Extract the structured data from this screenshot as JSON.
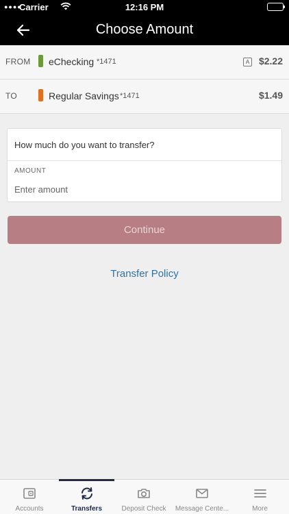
{
  "status_bar": {
    "carrier": "Carrier",
    "time": "12:16 PM"
  },
  "nav": {
    "title": "Choose Amount"
  },
  "from_account": {
    "direction": "FROM",
    "name": "eChecking",
    "number": "*1471",
    "badge": "A",
    "amount": "$2.22",
    "color": "#6a9a3a"
  },
  "to_account": {
    "direction": "TO",
    "name": "Regular Savings",
    "number": "*1471",
    "amount": "$1.49",
    "color": "#e07020"
  },
  "form": {
    "question": "How much do you want to transfer?",
    "amount_label": "AMOUNT",
    "amount_placeholder": "Enter amount",
    "amount_value": ""
  },
  "continue_label": "Continue",
  "policy_label": "Transfer Policy",
  "tabs": [
    {
      "label": "Accounts",
      "icon": "wallet-icon",
      "active": false
    },
    {
      "label": "Transfers",
      "icon": "transfer-icon",
      "active": true
    },
    {
      "label": "Deposit Check",
      "icon": "camera-icon",
      "active": false
    },
    {
      "label": "Message Cente...",
      "icon": "mail-icon",
      "active": false
    },
    {
      "label": "More",
      "icon": "menu-icon",
      "active": false
    }
  ],
  "colors": {
    "accent": "#1e2a47",
    "button_disabled": "#b77f84",
    "link": "#2e72a8"
  }
}
